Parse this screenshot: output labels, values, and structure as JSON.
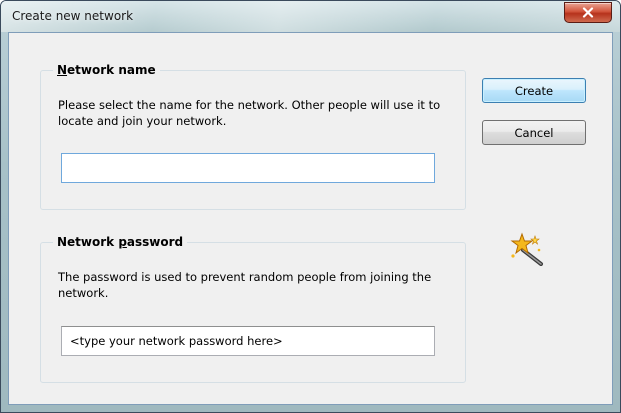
{
  "window": {
    "title": "Create new network"
  },
  "network_name": {
    "legend_prefix": "N",
    "legend_rest": "etwork name",
    "description": "Please select the name for the network. Other people will use it to locate and join your network.",
    "value": ""
  },
  "network_password": {
    "legend_prefix": "Network ",
    "legend_underlined": "p",
    "legend_rest": "assword",
    "description": "The password is used to prevent random people from joining the network.",
    "value": "<type your network password here>"
  },
  "buttons": {
    "create_label": "Create",
    "cancel_label": "Cancel"
  },
  "icons": {
    "close": "close-icon",
    "wizard": "magic-wand-icon"
  },
  "colors": {
    "close_button": "#c8452c",
    "default_button_border": "#3c7fb1",
    "focus_border": "#6fa8dc"
  }
}
